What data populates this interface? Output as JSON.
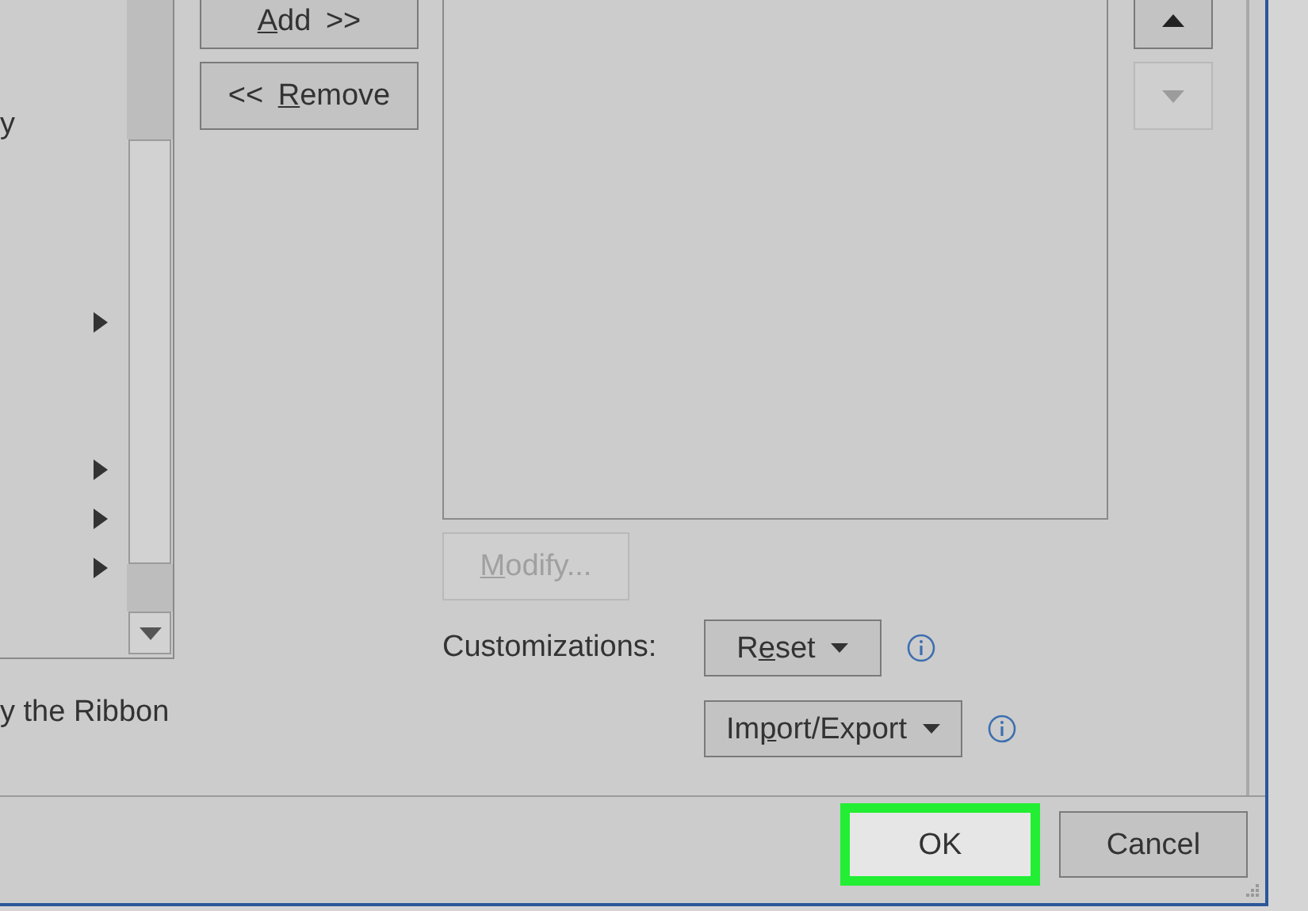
{
  "left_list": {
    "rows": [
      {
        "text": "y",
        "submenu": false
      },
      {
        "submenu": false
      },
      {
        "submenu": false
      },
      {
        "submenu": false
      },
      {
        "submenu": true
      },
      {
        "submenu": false
      },
      {
        "submenu": false
      },
      {
        "submenu": true
      },
      {
        "submenu": true
      },
      {
        "submenu": true
      }
    ]
  },
  "left_caption": "y the Ribbon",
  "move_buttons": [
    {
      "label_runs": [
        {
          "text": "A",
          "underlined": true
        },
        {
          "text": "dd >>",
          "underlined": false
        }
      ]
    },
    {
      "label_runs": [
        {
          "text": "<< ",
          "underlined": false
        },
        {
          "text": "R",
          "underlined": true
        },
        {
          "text": "emove",
          "underlined": false
        }
      ]
    }
  ],
  "modify_button": {
    "label_runs": [
      {
        "text": "M",
        "underlined": true
      },
      {
        "text": "odify...",
        "underlined": false
      }
    ],
    "disabled": true
  },
  "customizations": {
    "label": "Customizations:",
    "buttons": [
      {
        "label_runs": [
          {
            "text": "R",
            "underlined": false
          },
          {
            "text": "e",
            "underlined": true
          },
          {
            "text": "set",
            "underlined": false
          }
        ]
      },
      {
        "label_runs": [
          {
            "text": "Im",
            "underlined": false
          },
          {
            "text": "p",
            "underlined": true
          },
          {
            "text": "ort/Export",
            "underlined": false
          }
        ]
      }
    ]
  },
  "order_buttons": [
    {
      "kind": "up",
      "disabled": false
    },
    {
      "kind": "down",
      "disabled": true
    }
  ],
  "footer_buttons": [
    {
      "label": "OK",
      "highlighted": true
    },
    {
      "label": "Cancel",
      "highlighted": false
    }
  ]
}
